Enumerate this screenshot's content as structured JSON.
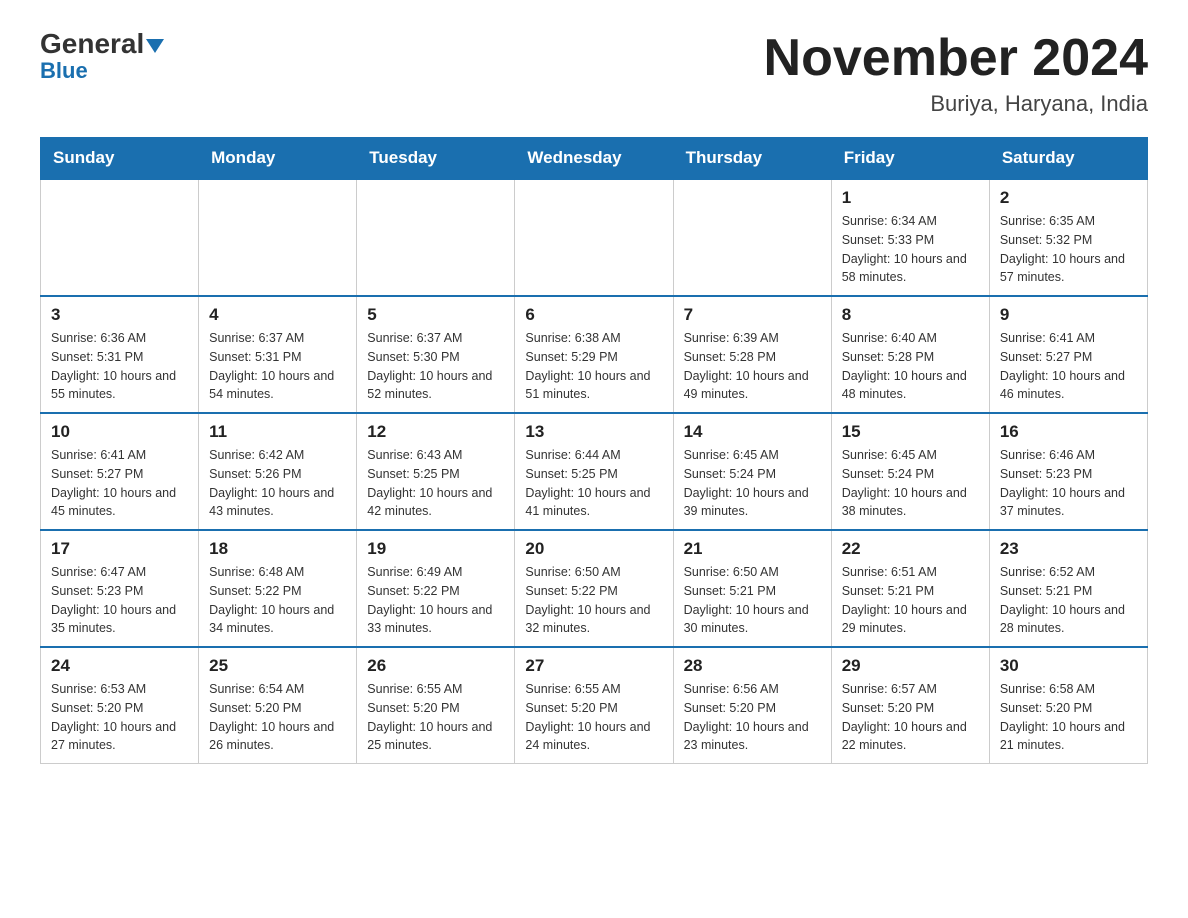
{
  "header": {
    "logo_general": "General",
    "logo_blue": "Blue",
    "month_title": "November 2024",
    "location": "Buriya, Haryana, India"
  },
  "days_of_week": [
    "Sunday",
    "Monday",
    "Tuesday",
    "Wednesday",
    "Thursday",
    "Friday",
    "Saturday"
  ],
  "weeks": [
    [
      {
        "day": "",
        "info": ""
      },
      {
        "day": "",
        "info": ""
      },
      {
        "day": "",
        "info": ""
      },
      {
        "day": "",
        "info": ""
      },
      {
        "day": "",
        "info": ""
      },
      {
        "day": "1",
        "info": "Sunrise: 6:34 AM\nSunset: 5:33 PM\nDaylight: 10 hours and 58 minutes."
      },
      {
        "day": "2",
        "info": "Sunrise: 6:35 AM\nSunset: 5:32 PM\nDaylight: 10 hours and 57 minutes."
      }
    ],
    [
      {
        "day": "3",
        "info": "Sunrise: 6:36 AM\nSunset: 5:31 PM\nDaylight: 10 hours and 55 minutes."
      },
      {
        "day": "4",
        "info": "Sunrise: 6:37 AM\nSunset: 5:31 PM\nDaylight: 10 hours and 54 minutes."
      },
      {
        "day": "5",
        "info": "Sunrise: 6:37 AM\nSunset: 5:30 PM\nDaylight: 10 hours and 52 minutes."
      },
      {
        "day": "6",
        "info": "Sunrise: 6:38 AM\nSunset: 5:29 PM\nDaylight: 10 hours and 51 minutes."
      },
      {
        "day": "7",
        "info": "Sunrise: 6:39 AM\nSunset: 5:28 PM\nDaylight: 10 hours and 49 minutes."
      },
      {
        "day": "8",
        "info": "Sunrise: 6:40 AM\nSunset: 5:28 PM\nDaylight: 10 hours and 48 minutes."
      },
      {
        "day": "9",
        "info": "Sunrise: 6:41 AM\nSunset: 5:27 PM\nDaylight: 10 hours and 46 minutes."
      }
    ],
    [
      {
        "day": "10",
        "info": "Sunrise: 6:41 AM\nSunset: 5:27 PM\nDaylight: 10 hours and 45 minutes."
      },
      {
        "day": "11",
        "info": "Sunrise: 6:42 AM\nSunset: 5:26 PM\nDaylight: 10 hours and 43 minutes."
      },
      {
        "day": "12",
        "info": "Sunrise: 6:43 AM\nSunset: 5:25 PM\nDaylight: 10 hours and 42 minutes."
      },
      {
        "day": "13",
        "info": "Sunrise: 6:44 AM\nSunset: 5:25 PM\nDaylight: 10 hours and 41 minutes."
      },
      {
        "day": "14",
        "info": "Sunrise: 6:45 AM\nSunset: 5:24 PM\nDaylight: 10 hours and 39 minutes."
      },
      {
        "day": "15",
        "info": "Sunrise: 6:45 AM\nSunset: 5:24 PM\nDaylight: 10 hours and 38 minutes."
      },
      {
        "day": "16",
        "info": "Sunrise: 6:46 AM\nSunset: 5:23 PM\nDaylight: 10 hours and 37 minutes."
      }
    ],
    [
      {
        "day": "17",
        "info": "Sunrise: 6:47 AM\nSunset: 5:23 PM\nDaylight: 10 hours and 35 minutes."
      },
      {
        "day": "18",
        "info": "Sunrise: 6:48 AM\nSunset: 5:22 PM\nDaylight: 10 hours and 34 minutes."
      },
      {
        "day": "19",
        "info": "Sunrise: 6:49 AM\nSunset: 5:22 PM\nDaylight: 10 hours and 33 minutes."
      },
      {
        "day": "20",
        "info": "Sunrise: 6:50 AM\nSunset: 5:22 PM\nDaylight: 10 hours and 32 minutes."
      },
      {
        "day": "21",
        "info": "Sunrise: 6:50 AM\nSunset: 5:21 PM\nDaylight: 10 hours and 30 minutes."
      },
      {
        "day": "22",
        "info": "Sunrise: 6:51 AM\nSunset: 5:21 PM\nDaylight: 10 hours and 29 minutes."
      },
      {
        "day": "23",
        "info": "Sunrise: 6:52 AM\nSunset: 5:21 PM\nDaylight: 10 hours and 28 minutes."
      }
    ],
    [
      {
        "day": "24",
        "info": "Sunrise: 6:53 AM\nSunset: 5:20 PM\nDaylight: 10 hours and 27 minutes."
      },
      {
        "day": "25",
        "info": "Sunrise: 6:54 AM\nSunset: 5:20 PM\nDaylight: 10 hours and 26 minutes."
      },
      {
        "day": "26",
        "info": "Sunrise: 6:55 AM\nSunset: 5:20 PM\nDaylight: 10 hours and 25 minutes."
      },
      {
        "day": "27",
        "info": "Sunrise: 6:55 AM\nSunset: 5:20 PM\nDaylight: 10 hours and 24 minutes."
      },
      {
        "day": "28",
        "info": "Sunrise: 6:56 AM\nSunset: 5:20 PM\nDaylight: 10 hours and 23 minutes."
      },
      {
        "day": "29",
        "info": "Sunrise: 6:57 AM\nSunset: 5:20 PM\nDaylight: 10 hours and 22 minutes."
      },
      {
        "day": "30",
        "info": "Sunrise: 6:58 AM\nSunset: 5:20 PM\nDaylight: 10 hours and 21 minutes."
      }
    ]
  ]
}
